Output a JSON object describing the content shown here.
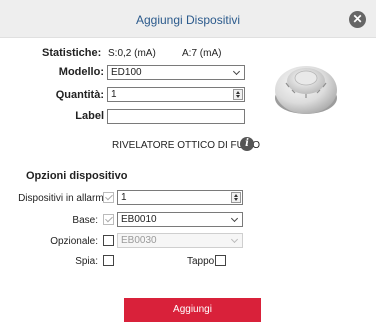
{
  "window": {
    "title": "Aggiungi Dispositivi"
  },
  "stats": {
    "label": "Statistiche:",
    "s_value": "S:0,2 (mA)",
    "a_value": "A:7 (mA)"
  },
  "model": {
    "label": "Modello:",
    "value": "ED100"
  },
  "quantity": {
    "label": "Quantità:",
    "value": "1"
  },
  "label_field": {
    "label": "Label",
    "value": ""
  },
  "description": "RIVELATORE OTTICO DI FUMO",
  "options": {
    "header": "Opzioni dispositivo",
    "devices_in_alarm": {
      "label": "Dispositivi in allarme:",
      "checked": true,
      "value": "1"
    },
    "base": {
      "label": "Base:",
      "checked": true,
      "value": "EB0010"
    },
    "optional": {
      "label": "Opzionale:",
      "checked": false,
      "value": "EB0030"
    },
    "spia": {
      "label": "Spia:",
      "checked": false
    },
    "tappo": {
      "label": "Tappo",
      "checked": false
    }
  },
  "add_button": "Aggiungi",
  "icons": {
    "close": "close-icon",
    "info": "info-icon",
    "device": "smoke-detector-image"
  },
  "colors": {
    "title": "#2b5a8c",
    "accent": "#d9213a"
  }
}
